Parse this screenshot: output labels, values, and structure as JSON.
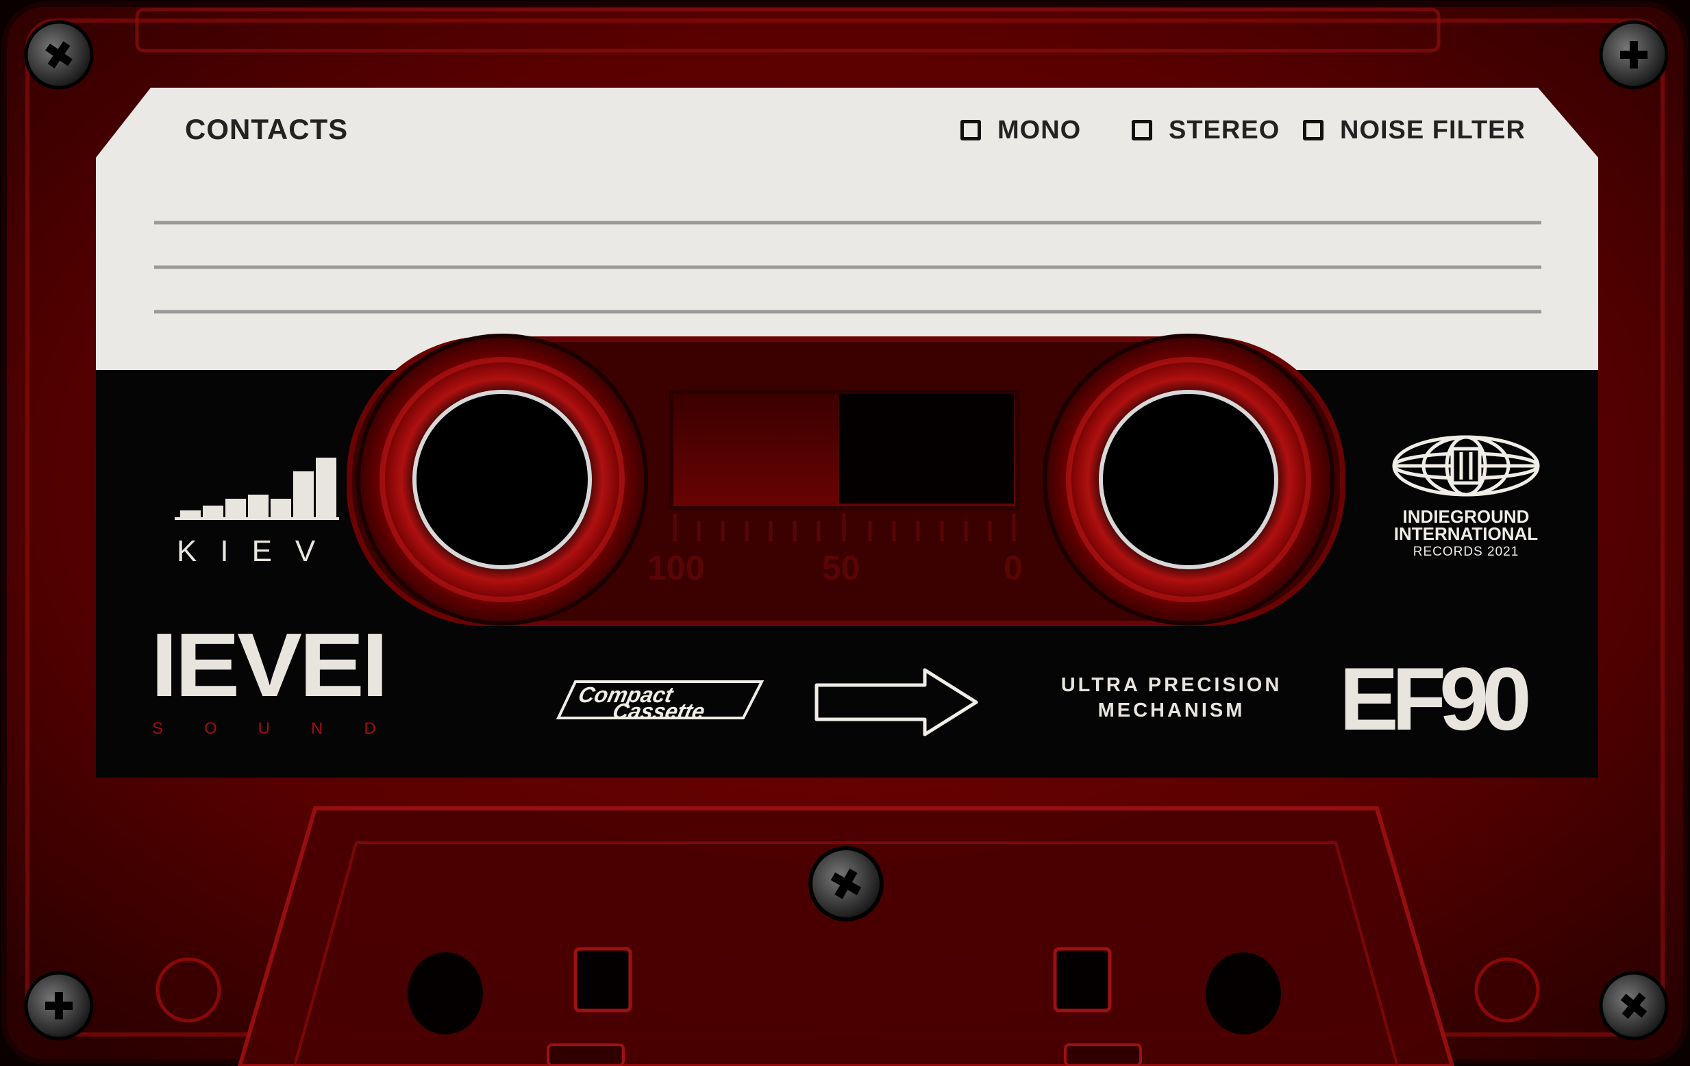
{
  "label": {
    "title": "CONTACTS",
    "options": [
      "MONO",
      "STEREO",
      "NOISE FILTER"
    ]
  },
  "brand": {
    "city": "KIEV",
    "logo": "IEVEI",
    "tagline": "SOUND"
  },
  "format": {
    "cassette_line1": "Compact",
    "cassette_line2": "Cassette",
    "mechanism": [
      "ULTRA PRECISION",
      "MECHANISM"
    ],
    "model": "EF90"
  },
  "publisher": {
    "line1": "INDIEGROUND",
    "line2": "INTERNATIONAL",
    "line3": "RECORDS 2021"
  },
  "tape_scale": [
    "100",
    "50",
    "0"
  ],
  "colors": {
    "shell": "#6e0000",
    "shell_dark": "#2a0000",
    "label_paper": "#ebe9e5",
    "label_band": "#050505",
    "accent_red": "#a40d0d"
  },
  "icons": [
    "level-bars-icon",
    "globe-icon",
    "arrow-right-icon",
    "screw-icon"
  ]
}
